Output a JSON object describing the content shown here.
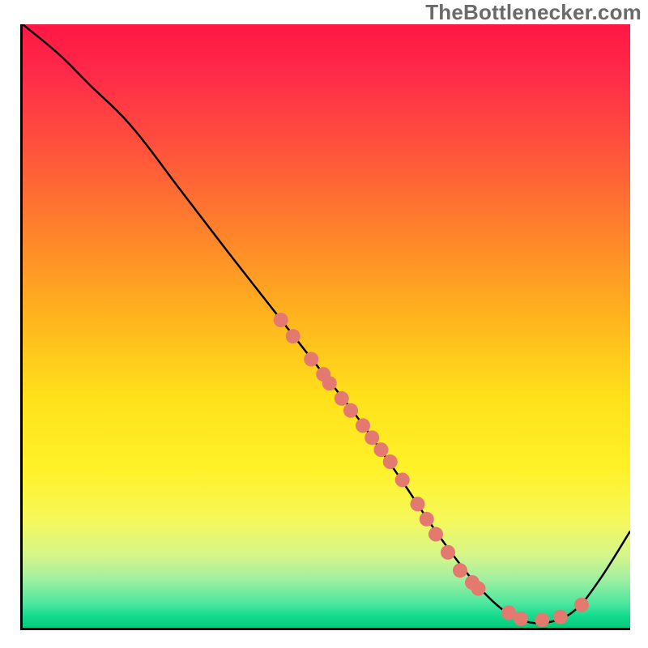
{
  "watermark": "TheBottlenecker.com",
  "chart_data": {
    "type": "line",
    "title": "",
    "xlabel": "",
    "ylabel": "",
    "xlim": [
      0,
      100
    ],
    "ylim": [
      0,
      100
    ],
    "curve": {
      "x": [
        0,
        6,
        11,
        18,
        26,
        34,
        41,
        48,
        55,
        62,
        68,
        74,
        79,
        83,
        87,
        91,
        95,
        100
      ],
      "y": [
        100,
        95,
        90,
        83,
        72.5,
        62,
        53,
        44,
        35,
        25,
        16,
        8,
        3,
        1,
        1,
        3,
        8,
        16
      ]
    },
    "points": [
      {
        "x": 42.5,
        "y": 51
      },
      {
        "x": 44.5,
        "y": 48.3
      },
      {
        "x": 47.5,
        "y": 44.5
      },
      {
        "x": 49.5,
        "y": 42
      },
      {
        "x": 50.5,
        "y": 40.5
      },
      {
        "x": 52.5,
        "y": 38
      },
      {
        "x": 54,
        "y": 36
      },
      {
        "x": 56,
        "y": 33.5
      },
      {
        "x": 57.5,
        "y": 31.5
      },
      {
        "x": 59,
        "y": 29.5
      },
      {
        "x": 60.5,
        "y": 27.5
      },
      {
        "x": 62.5,
        "y": 24.5
      },
      {
        "x": 65,
        "y": 20.5
      },
      {
        "x": 66.5,
        "y": 18
      },
      {
        "x": 68,
        "y": 15.5
      },
      {
        "x": 70,
        "y": 12.5
      },
      {
        "x": 72,
        "y": 9.5
      },
      {
        "x": 74,
        "y": 7.5
      },
      {
        "x": 75,
        "y": 6.5
      },
      {
        "x": 80,
        "y": 2.5
      },
      {
        "x": 82,
        "y": 1.5
      },
      {
        "x": 85.5,
        "y": 1.3
      },
      {
        "x": 88.5,
        "y": 1.8
      },
      {
        "x": 92,
        "y": 3.8
      }
    ],
    "point_color": "#e3796f",
    "point_radius": 9
  }
}
